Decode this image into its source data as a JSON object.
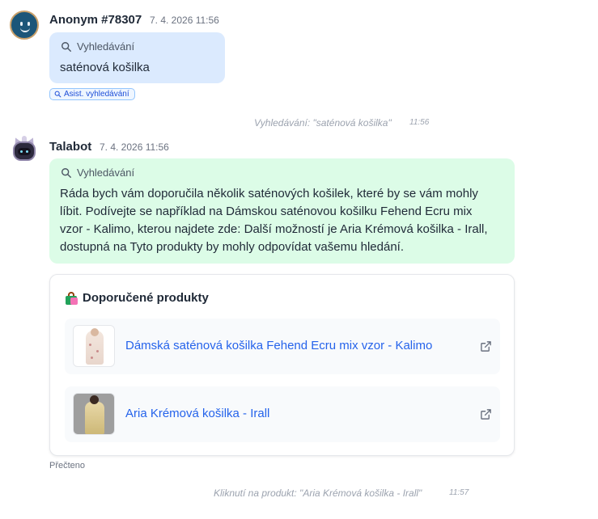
{
  "messages": [
    {
      "author": "Anonym #78307",
      "timestamp": "7. 4. 2026 11:56",
      "bubble_label": "Vyhledávání",
      "text": "saténová košilka",
      "chip": "Asist. vyhledávání"
    },
    {
      "author": "Talabot",
      "timestamp": "7. 4. 2026 11:56",
      "bubble_label": "Vyhledávání",
      "text_lines": [
        "Ráda bych vám doporučila několik saténových košilek, které by se vám mohly",
        "líbit. Podívejte se například na Dámskou saténovou košilku Fehend Ecru mix",
        "vzor - Kalimo, kterou najdete zde: Další možností je Aria Krémová košilka - Irall,",
        "dostupná na Tyto produkty by mohly odpovídat vašemu hledání."
      ]
    }
  ],
  "system_events": [
    {
      "text": "Vyhledávání: \"saténová košilka\"",
      "time": "11:56"
    },
    {
      "text": "Kliknutí na produkt: \"Aria Krémová košilka - Irall\"",
      "time": "11:57"
    }
  ],
  "recommendations": {
    "title": "Doporučené produkty",
    "products": [
      {
        "name": "Dámská saténová košilka Fehend Ecru mix vzor - Kalimo"
      },
      {
        "name": "Aria Krémová košilka - Irall"
      }
    ]
  },
  "read_status": "Přečteno",
  "colors": {
    "user_bubble": "#dbeafe",
    "bot_bubble": "#dcfce7",
    "link": "#2563eb",
    "chip_border": "#93c5fd"
  },
  "icons": {
    "bubble_label": "search-icon",
    "product_action": "external-link-icon",
    "card_title": "shopping-bags-icon"
  }
}
